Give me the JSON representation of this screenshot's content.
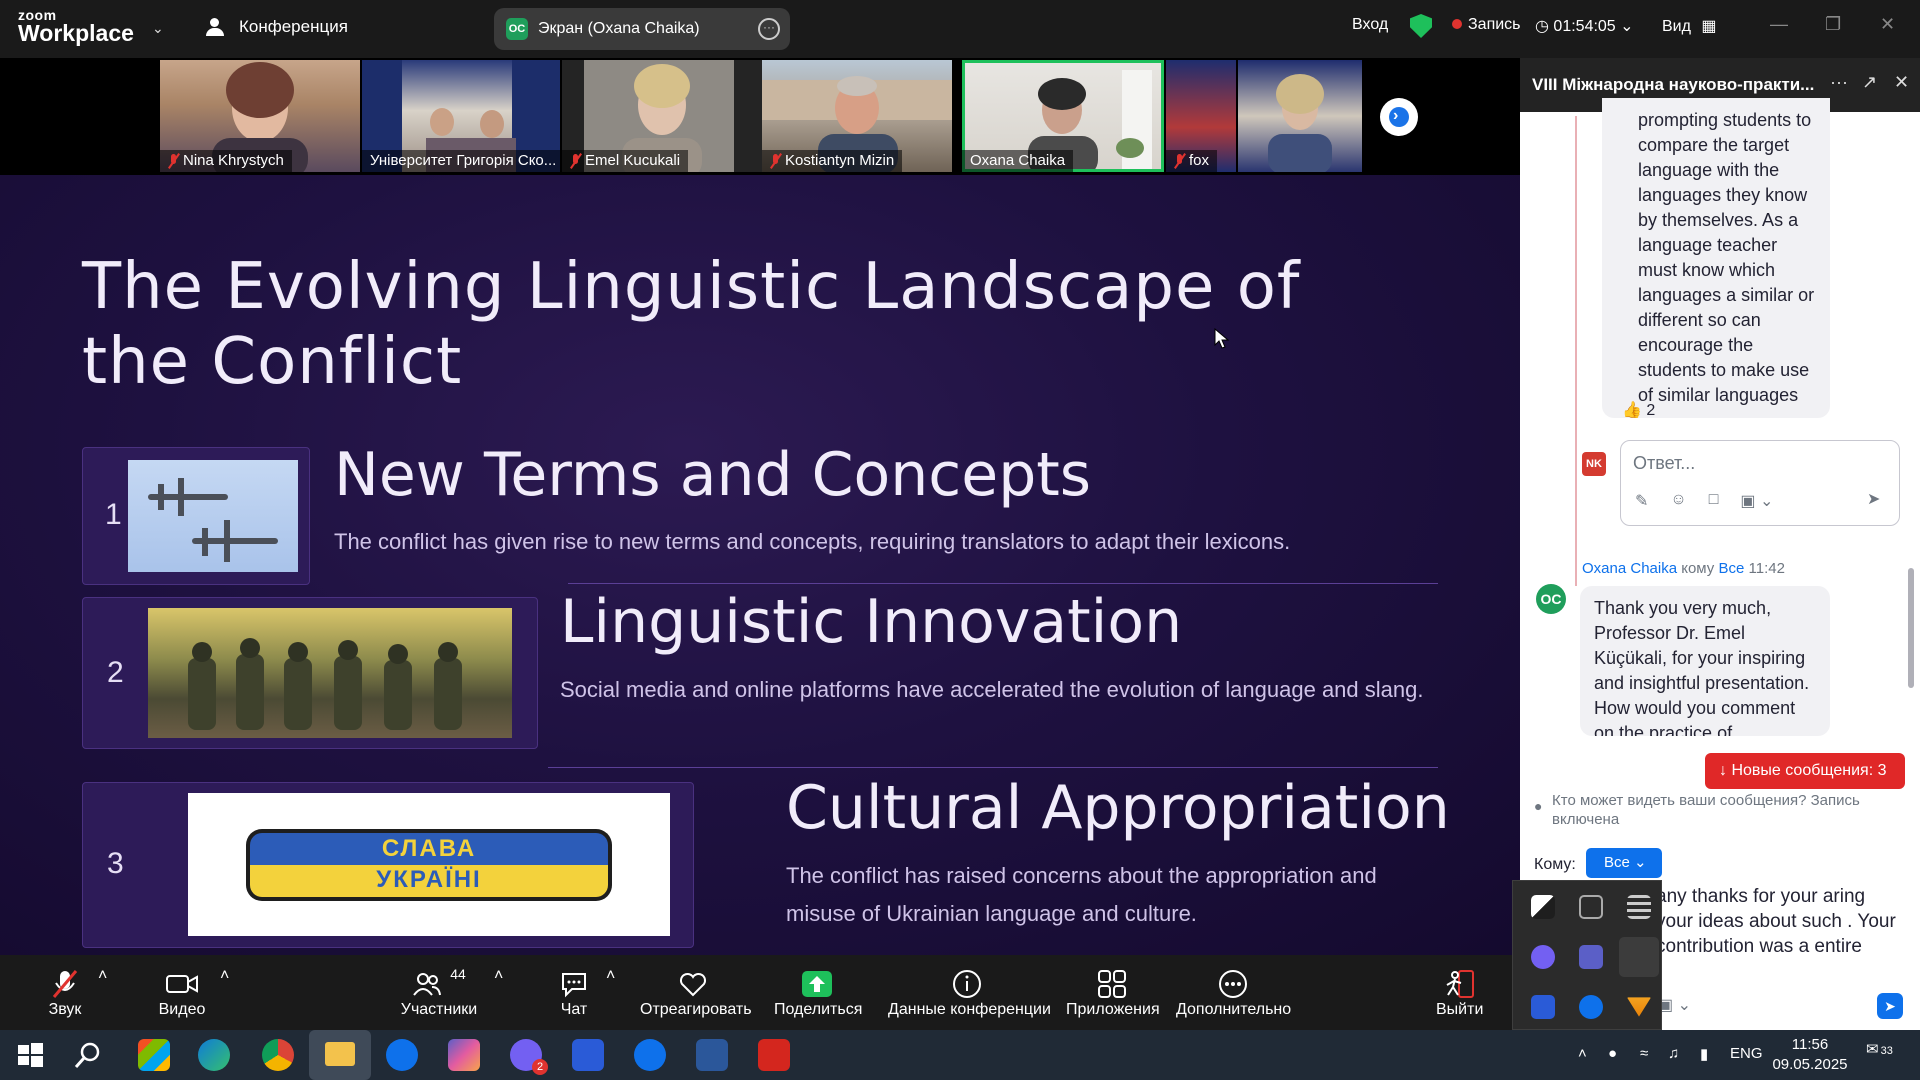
{
  "app": {
    "logo_line1": "zoom",
    "logo_line2": "Workplace",
    "conference_label": "Конференция",
    "share_initials": "OC",
    "share_title": "Экран (Oxana Chaika)",
    "signin": "Вход",
    "record": "Запись",
    "timer": "01:54:05",
    "view": "Вид"
  },
  "video_strip": [
    {
      "name": "Nina Khrystych",
      "muted": true
    },
    {
      "name": "Університет Григорія Ско...",
      "muted": false
    },
    {
      "name": "Emel Kucukali",
      "muted": true
    },
    {
      "name": "Kostiantyn Mizin",
      "muted": true
    },
    {
      "name": "Oxana Chaika",
      "muted": false,
      "active": true
    },
    {
      "name": "fox",
      "muted": true
    },
    {
      "name": "",
      "muted": false
    }
  ],
  "slide": {
    "title": "The Evolving Linguistic Landscape of the Conflict",
    "items": [
      {
        "num": "1",
        "heading": "New Terms and Concepts",
        "text": "The conflict has given rise to new terms and concepts, requiring translators to adapt their lexicons."
      },
      {
        "num": "2",
        "heading": "Linguistic Innovation",
        "text": "Social media and online platforms have accelerated the evolution of language and slang."
      },
      {
        "num": "3",
        "heading": "Cultural Appropriation",
        "text": "The conflict has raised concerns about the appropriation and misuse of Ukrainian language and culture."
      }
    ],
    "patch_line1": "СЛАВА",
    "patch_line2": "УКРАЇНІ"
  },
  "chat": {
    "title": "VIII Міжнародна науково-практи...",
    "prev_message": "prompting students to compare the target language with the languages they know by themselves. As a language teacher must know which languages a similar or different so can encourage the students to make use of similar languages",
    "reaction": "👍 2",
    "reply_avatar": "NK",
    "reply_placeholder": "Ответ...",
    "sender_name": "Oxana Chaika",
    "sender_to": "кому",
    "sender_target": "Все",
    "sender_time": "11:42",
    "sender_avatar": "OC",
    "message": "Thank you very much, Professor Dr. Emel Küçükali, for your inspiring and insightful presentation. How would you comment on the practice of translanguaging in classrooms where bilingual teac",
    "new_messages": "Новые сообщения: 3",
    "privacy": "Кто может видеть ваши сообщения? Запись включена",
    "to_label": "Кому:",
    "to_value": "Все",
    "compose_text": "any thanks for your aring your ideas about such . Your contribution was a entire program."
  },
  "toolbar": {
    "audio": "Звук",
    "video": "Видео",
    "participants": "Участники",
    "participants_count": "44",
    "chat": "Чат",
    "react": "Отреагировать",
    "share": "Поделиться",
    "info": "Данные конференции",
    "apps": "Приложения",
    "more": "Дополнительно",
    "leave": "Выйти"
  },
  "taskbar": {
    "lang": "ENG",
    "time": "11:56",
    "date": "09.05.2025",
    "notif_count": "33",
    "viber_badge": "2"
  },
  "colors": {
    "zoom_blue": "#0e71eb",
    "active_green": "#1ec05b",
    "record_red": "#e0332f",
    "slide_bg": "#1e1140"
  }
}
